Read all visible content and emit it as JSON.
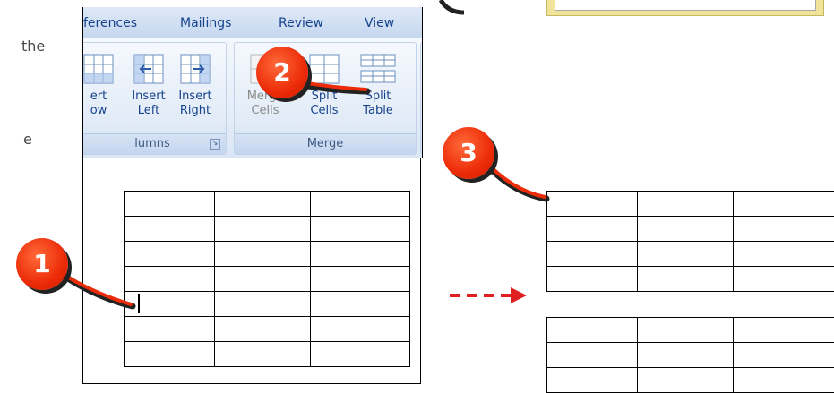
{
  "side_text": [
    "the",
    "e"
  ],
  "ribbon": {
    "tabs": [
      "ferences",
      "Mailings",
      "Review",
      "View"
    ],
    "groups": {
      "columns": {
        "label": "lumns",
        "buttons": [
          {
            "line1": "ert",
            "line2": "ow"
          },
          {
            "line1": "Insert",
            "line2": "Left"
          },
          {
            "line1": "Insert",
            "line2": "Right"
          }
        ]
      },
      "merge": {
        "label": "Merge",
        "buttons": [
          {
            "line1": "Merge",
            "line2": "Cells"
          },
          {
            "line1": "Split",
            "line2": "Cells"
          },
          {
            "line1": "Split",
            "line2": "Table"
          }
        ]
      }
    }
  },
  "callouts": [
    "1",
    "2",
    "3"
  ],
  "tables": {
    "before": {
      "rows": 7,
      "cols": 3
    },
    "after_top": {
      "rows": 4,
      "cols": 3
    },
    "after_bottom": {
      "rows": 3,
      "cols": 3
    }
  },
  "colors": {
    "callout": "#ec2b08",
    "arrow": "#e02020",
    "ribbon_text": "#15428b"
  }
}
